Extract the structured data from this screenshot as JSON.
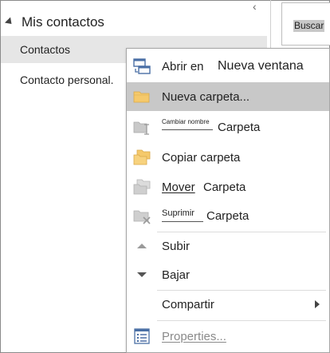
{
  "folder_pane": {
    "title": "Mis contactos",
    "items": [
      {
        "label": "Contactos"
      },
      {
        "label": "Contacto personal."
      }
    ]
  },
  "toolbar": {
    "search_label": "Buscar"
  },
  "context_menu": {
    "open_in": {
      "label_a": "Abrir en",
      "label_b": "Nueva ventana",
      "icon": "new-window-icon"
    },
    "new_folder": {
      "label": "Nueva carpeta...",
      "icon": "folder-icon"
    },
    "rename": {
      "small_label": "Cambiar nombre",
      "label": "Carpeta",
      "icon": "rename-folder-icon"
    },
    "copy": {
      "label": "Copiar carpeta",
      "icon": "copy-folder-icon"
    },
    "move": {
      "label_a": "Mover",
      "label_b": "Carpeta",
      "icon": "move-folder-icon"
    },
    "delete": {
      "label_a": "Suprimir",
      "label_b": "Carpeta",
      "icon": "delete-folder-icon"
    },
    "up": {
      "label": "Subir",
      "icon": "triangle-up-icon"
    },
    "down": {
      "label": "Bajar",
      "icon": "triangle-down-icon"
    },
    "share": {
      "label": "Compartir",
      "icon": "chevron-right-icon"
    },
    "properties": {
      "label": "Properties...",
      "icon": "properties-icon"
    }
  },
  "colors": {
    "hover": "#c8c8c8",
    "selected": "#e6e6e6",
    "folder_yellow": "#f5c96b",
    "disabled_grey": "#9a9a9a"
  }
}
